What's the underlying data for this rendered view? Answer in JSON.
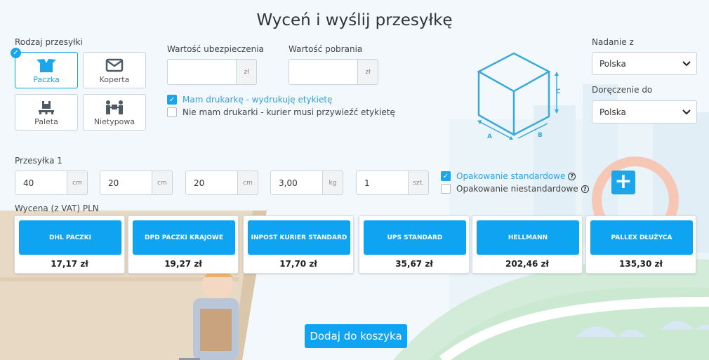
{
  "title": "Wyceń i wyślij przesyłkę",
  "shipment_type": {
    "label": "Rodzaj przesyłki",
    "options": [
      {
        "label": "Paczka",
        "icon": "box-open-icon",
        "selected": true
      },
      {
        "label": "Koperta",
        "icon": "envelope-icon",
        "selected": false
      },
      {
        "label": "Paleta",
        "icon": "pallet-icon",
        "selected": false
      },
      {
        "label": "Nietypowa",
        "icon": "people-carry-icon",
        "selected": false
      }
    ]
  },
  "insurance": {
    "label": "Wartość ubezpieczenia",
    "value": "",
    "unit": "zł"
  },
  "cod": {
    "label": "Wartość pobrania",
    "value": "",
    "unit": "zł"
  },
  "printer": {
    "have_printer": {
      "label": "Mam drukarkę - wydrukuję etykietę",
      "checked": true
    },
    "no_printer": {
      "label": "Nie mam drukarki - kurier musi przywieźć etykietę",
      "checked": false
    }
  },
  "box_diagram": {
    "label_a": "A",
    "label_b": "B",
    "label_c": "C"
  },
  "origin": {
    "label": "Nadanie z",
    "value": "Polska"
  },
  "destination": {
    "label": "Doręczenie do",
    "value": "Polska"
  },
  "parcel": {
    "label": "Przesyłka 1",
    "length": {
      "value": "40",
      "unit": "cm"
    },
    "width": {
      "value": "20",
      "unit": "cm"
    },
    "height": {
      "value": "20",
      "unit": "cm"
    },
    "weight": {
      "value": "3,00",
      "unit": "kg"
    },
    "quantity": {
      "value": "1",
      "unit": "szt."
    },
    "standard_packaging": {
      "label": "Opakowanie standardowe",
      "checked": true
    },
    "nonstandard_packaging": {
      "label": "Opakowanie niestandardowe",
      "checked": false
    },
    "add_label": "+"
  },
  "pricing": {
    "label": "Wycena (z VAT) PLN",
    "carriers": [
      {
        "name": "DHL PACZKI",
        "price": "17,17 zł"
      },
      {
        "name": "DPD PACZKI KRAJOWE",
        "price": "19,27 zł"
      },
      {
        "name": "INPOST KURIER STANDARD",
        "price": "17,70 zł"
      },
      {
        "name": "UPS STANDARD",
        "price": "35,67 zł"
      },
      {
        "name": "HELLMANN",
        "price": "202,46 zł"
      },
      {
        "name": "PALLEX DŁUŻYCA",
        "price": "135,30 zł"
      }
    ]
  },
  "cart_button": "Dodaj do koszyka",
  "colors": {
    "accent": "#0fa4f1",
    "active_text": "#2fa2dd",
    "diagram": "#3aaad8"
  }
}
